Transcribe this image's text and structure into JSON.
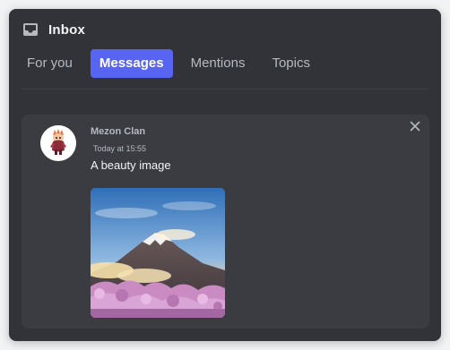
{
  "header": {
    "title": "Inbox",
    "icon": "inbox-icon"
  },
  "tabs": [
    {
      "label": "For you",
      "active": false
    },
    {
      "label": "Messages",
      "active": true
    },
    {
      "label": "Mentions",
      "active": false
    },
    {
      "label": "Topics",
      "active": false
    }
  ],
  "notification": {
    "author": "Mezon Clan",
    "timestamp": "Today at 15:55",
    "content": "A beauty image",
    "close_icon": "close-icon",
    "avatar_icon": "avatar-character-icon",
    "image_icon": "mountain-landscape-image"
  },
  "colors": {
    "panel_bg": "#313338",
    "card_bg": "#3a3c42",
    "accent": "#5865f2",
    "text_muted": "#b5bac1",
    "text_primary": "#f2f3f5"
  }
}
